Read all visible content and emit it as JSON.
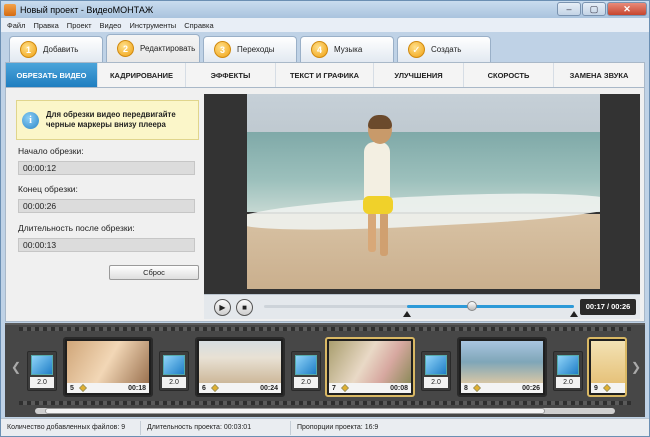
{
  "window": {
    "title": "Новый проект - ВидеоМОНТАЖ",
    "controls": [
      "‒",
      "▢",
      "✕"
    ]
  },
  "menu": [
    "Файл",
    "Правка",
    "Проект",
    "Видео",
    "Инструменты",
    "Справка"
  ],
  "main_tabs": [
    {
      "num": "1",
      "label": "Добавить"
    },
    {
      "num": "2",
      "label": "Редактировать",
      "active": true
    },
    {
      "num": "3",
      "label": "Переходы"
    },
    {
      "num": "4",
      "label": "Музыка"
    },
    {
      "num": "✓",
      "label": "Создать"
    }
  ],
  "sub_tabs": [
    {
      "label": "ОБРЕЗАТЬ ВИДЕО",
      "active": true
    },
    {
      "label": "КАДРИРОВАНИЕ"
    },
    {
      "label": "ЭФФЕКТЫ"
    },
    {
      "label": "ТЕКСТ И ГРАФИКА"
    },
    {
      "label": "УЛУЧШЕНИЯ"
    },
    {
      "label": "СКОРОСТЬ"
    },
    {
      "label": "ЗАМЕНА ЗВУКА"
    }
  ],
  "trim": {
    "hint": "Для обрезки видео передвигайте черные маркеры внизу плеера",
    "start_label": "Начало обрезки:",
    "start_value": "00:00:12",
    "end_label": "Конец обрезки:",
    "end_value": "00:00:26",
    "duration_label": "Длительность после обрезки:",
    "duration_value": "00:00:13",
    "reset_label": "Сброс"
  },
  "player": {
    "time": "00:17 / 00:26",
    "progress": 0.67,
    "marker_start": 0.46,
    "marker_end": 1.0
  },
  "timeline": {
    "clips": [
      {
        "num": "5",
        "time": "00:18",
        "selected": false
      },
      {
        "num": "6",
        "time": "00:24",
        "selected": false
      },
      {
        "num": "7",
        "time": "00:08",
        "selected": true
      },
      {
        "num": "8",
        "time": "00:26",
        "selected": false
      },
      {
        "num": "9",
        "time": "",
        "selected": false
      }
    ],
    "transition_label": "2.0"
  },
  "status": {
    "files": "Количество добавленных файлов: 9",
    "duration": "Длительность проекта: 00:03:01",
    "ratio": "Пропорции проекта: 16:9"
  },
  "colors": {
    "accent": "#1f7ec0",
    "tab_number": "#f0a010",
    "hint_bg": "#fbf6c9"
  }
}
